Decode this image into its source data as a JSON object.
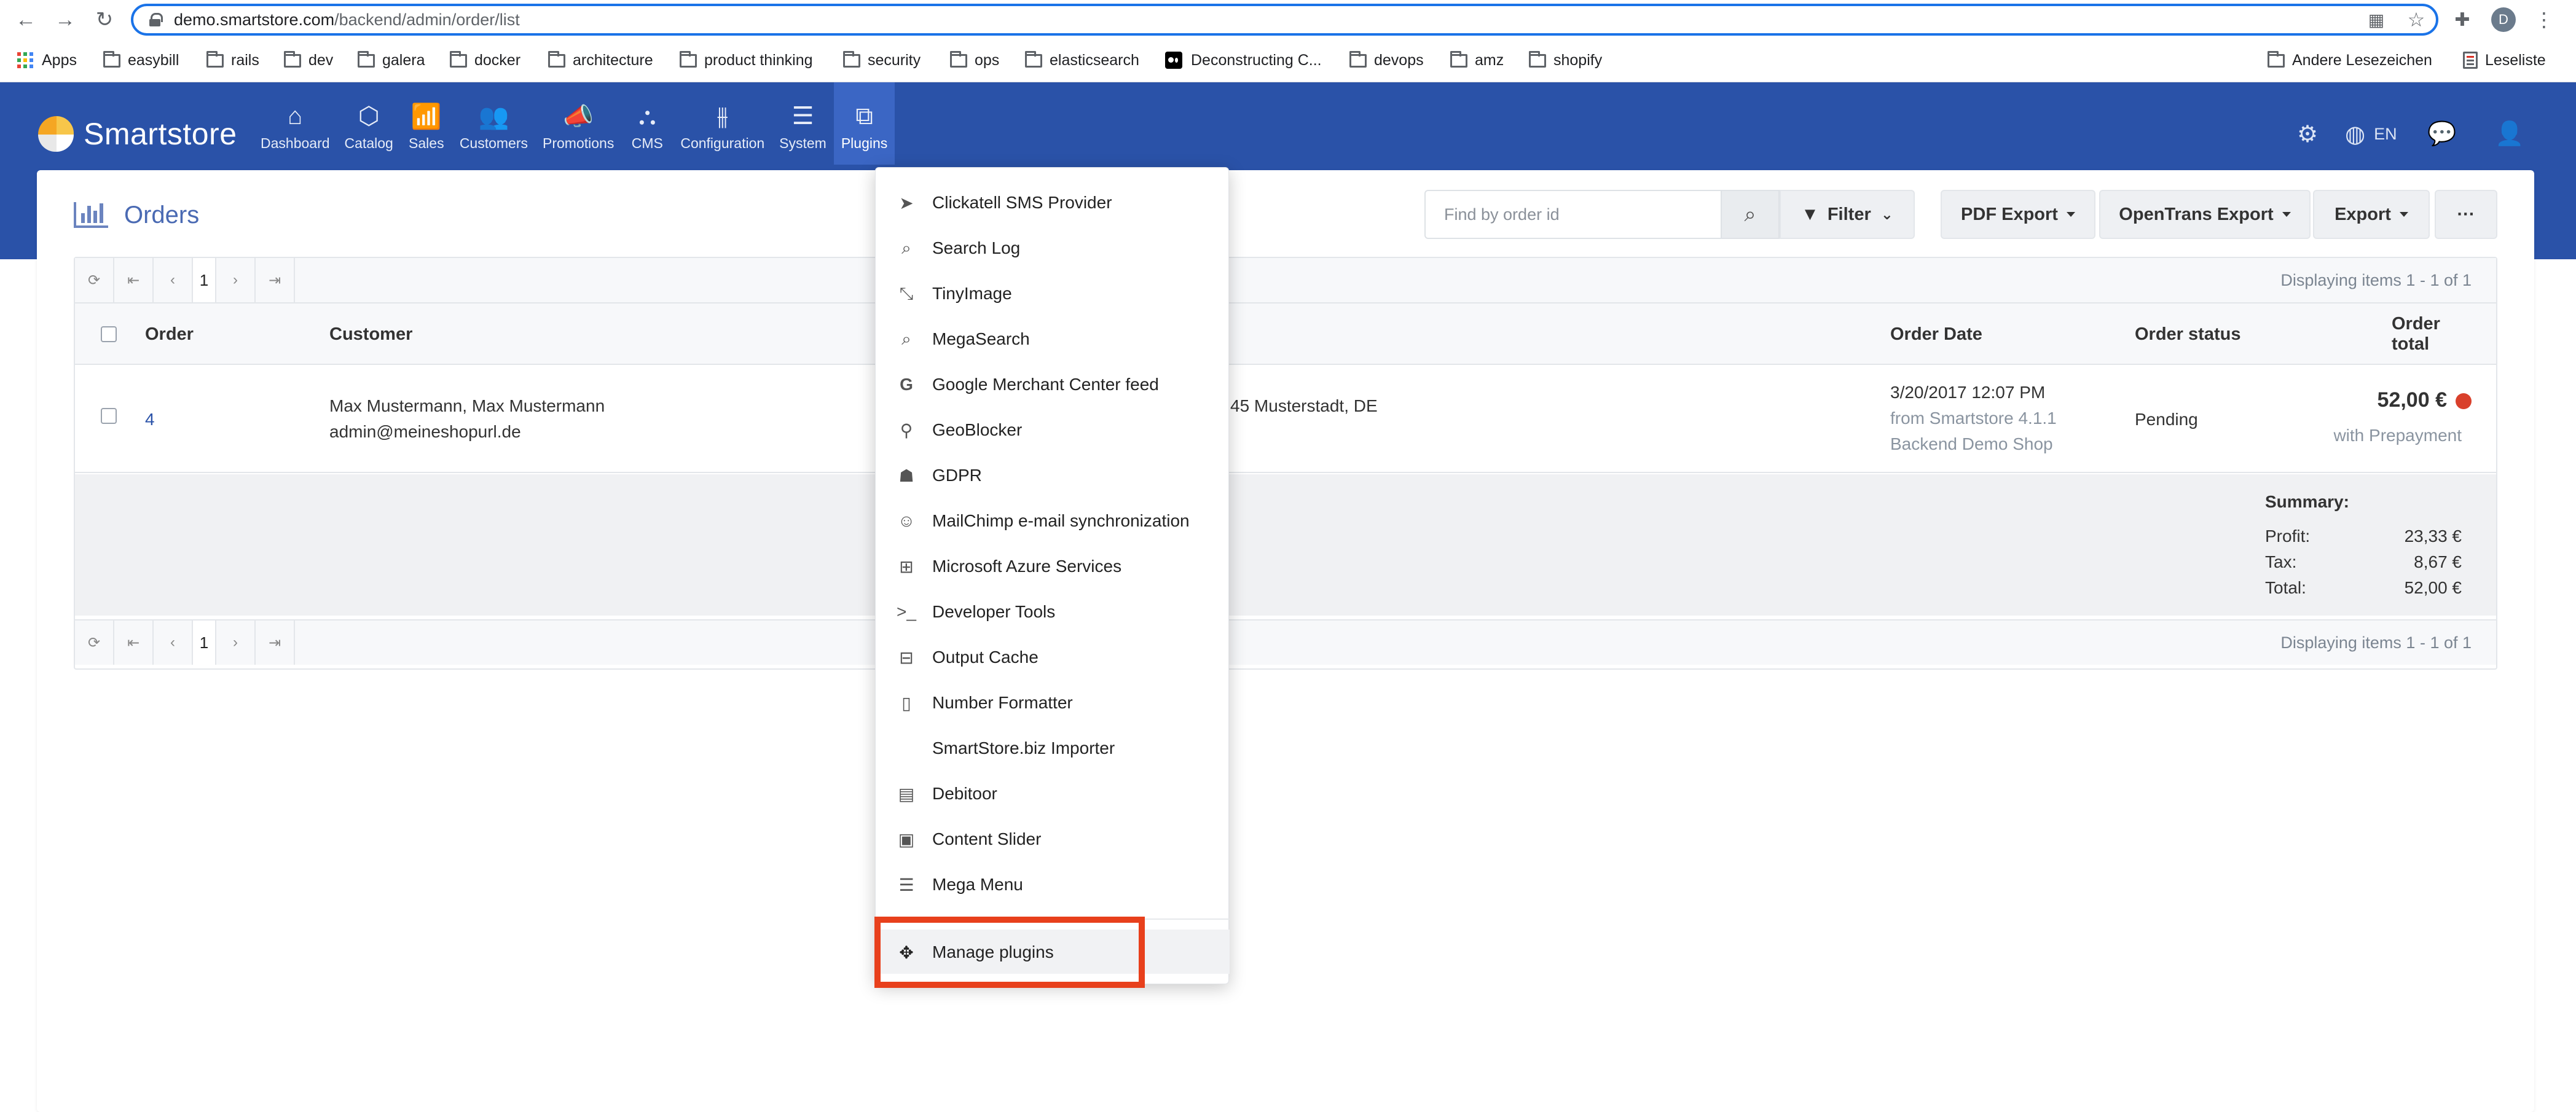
{
  "browser": {
    "url_host": "demo.smartstore.com",
    "url_path": "/backend/admin/order/list",
    "profile_initial": "D",
    "bookmarks": [
      "Apps",
      "easybill",
      "rails",
      "dev",
      "galera",
      "docker",
      "architecture",
      "product thinking",
      "security",
      "ops",
      "elasticsearch",
      "Deconstructing C...",
      "devops",
      "amz",
      "shopify"
    ],
    "other_bookmarks": "Andere Lesezeichen",
    "reading_list": "Leseliste"
  },
  "app": {
    "brand": "Smartstore",
    "nav": [
      {
        "label": "Dashboard",
        "icon": "home-icon"
      },
      {
        "label": "Catalog",
        "icon": "cube-icon"
      },
      {
        "label": "Sales",
        "icon": "chart-icon"
      },
      {
        "label": "Customers",
        "icon": "users-icon"
      },
      {
        "label": "Promotions",
        "icon": "megaphone-icon"
      },
      {
        "label": "CMS",
        "icon": "sitemap-icon"
      },
      {
        "label": "Configuration",
        "icon": "sliders-icon"
      },
      {
        "label": "System",
        "icon": "database-icon"
      },
      {
        "label": "Plugins",
        "icon": "puzzle-icon"
      }
    ],
    "active_nav": "Plugins",
    "language": "EN"
  },
  "page": {
    "title": "Orders",
    "search_placeholder": "Find by order id",
    "filter_label": "Filter",
    "pdf_export": "PDF Export",
    "opentrans_export": "OpenTrans Export",
    "export": "Export",
    "more": "···"
  },
  "grid": {
    "page_number": "1",
    "displaying": "Displaying items 1 - 1 of 1",
    "columns": [
      "Order",
      "Customer",
      "Order Date",
      "Order status",
      "Order total"
    ],
    "rows": [
      {
        "order": "4",
        "customer_name": "Max Mustermann, Max Mustermann",
        "customer_email": "admin@meineshopurl.de",
        "address_fragment": "45 Musterstadt, DE",
        "date": "3/20/2017 12:07 PM",
        "from": "from Smartstore 4.1.1",
        "shop": "Backend Demo Shop",
        "status": "Pending",
        "total": "52,00 €",
        "payment": "with Prepayment"
      }
    ],
    "summary": {
      "title": "Summary:",
      "profit_label": "Profit:",
      "profit": "23,33 €",
      "tax_label": "Tax:",
      "tax": "8,67 €",
      "total_label": "Total:",
      "total": "52,00 €"
    }
  },
  "plugins_menu": {
    "items": [
      {
        "label": "Clickatell SMS Provider",
        "icon": "paper-plane-icon"
      },
      {
        "label": "Search Log",
        "icon": "search-icon"
      },
      {
        "label": "TinyImage",
        "icon": "compress-icon"
      },
      {
        "label": "MegaSearch",
        "icon": "search-icon"
      },
      {
        "label": "Google Merchant Center feed",
        "icon": "google-icon"
      },
      {
        "label": "GeoBlocker",
        "icon": "map-pin-icon"
      },
      {
        "label": "GDPR",
        "icon": "user-secret-icon"
      },
      {
        "label": "MailChimp e-mail synchronization",
        "icon": "mailchimp-icon"
      },
      {
        "label": "Microsoft Azure Services",
        "icon": "windows-icon"
      },
      {
        "label": "Developer Tools",
        "icon": "terminal-icon"
      },
      {
        "label": "Output Cache",
        "icon": "hdd-icon"
      },
      {
        "label": "Number Formatter",
        "icon": "file-icon"
      },
      {
        "label": "SmartStore.biz Importer",
        "icon": ""
      },
      {
        "label": "Debitoor",
        "icon": "calculator-icon"
      },
      {
        "label": "Content Slider",
        "icon": "images-icon"
      },
      {
        "label": "Mega Menu",
        "icon": "list-icon"
      }
    ],
    "manage": {
      "label": "Manage plugins",
      "icon": "puzzle-icon"
    },
    "highlight_color": "#e8401c"
  },
  "colors": {
    "header_bg": "#2a52a8",
    "active_nav_bg": "#3b66c4",
    "accent_link": "#2a52a8",
    "status_dot": "#d9402b"
  }
}
